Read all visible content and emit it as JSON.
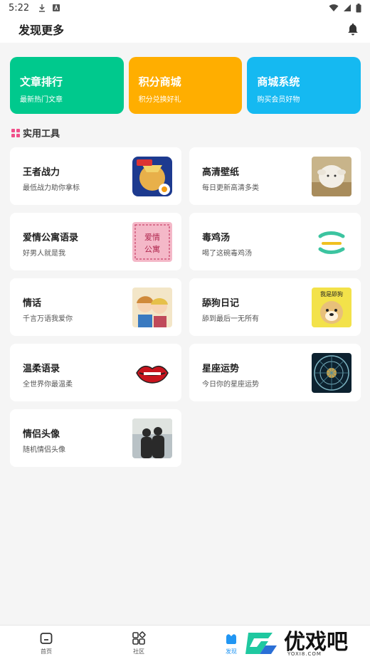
{
  "status_bar": {
    "time": "5:22"
  },
  "app_bar": {
    "title": "发现更多"
  },
  "features": [
    {
      "title": "文章排行",
      "subtitle": "最新热门文章",
      "color": "#00c98d"
    },
    {
      "title": "积分商城",
      "subtitle": "积分兑换好礼",
      "color": "#ffae00"
    },
    {
      "title": "商城系统",
      "subtitle": "购买会员好物",
      "color": "#15b9f1"
    }
  ],
  "section": {
    "title": "实用工具",
    "accent": "#f0508a"
  },
  "tools": [
    {
      "title": "王者战力",
      "subtitle": "最低战力助你拿标",
      "thumb": "game-hero-thumbnail"
    },
    {
      "title": "高清壁纸",
      "subtitle": "每日更新高清多类",
      "thumb": "plush-sheep-thumbnail"
    },
    {
      "title": "爱情公寓语录",
      "subtitle": "好男人就是我",
      "thumb": "love-apartment-thumbnail",
      "thumb_text": "爱情公寓"
    },
    {
      "title": "毒鸡汤",
      "subtitle": "喝了这碗毒鸡汤",
      "thumb": "chicken-soup-logo-thumbnail"
    },
    {
      "title": "情话",
      "subtitle": "千言万语我爱你",
      "thumb": "anime-couple-thumbnail"
    },
    {
      "title": "舔狗日记",
      "subtitle": "舔到最后一无所有",
      "thumb": "dog-meme-thumbnail",
      "thumb_text": "我是舔狗"
    },
    {
      "title": "温柔语录",
      "subtitle": "全世界你最温柔",
      "thumb": "red-lips-thumbnail"
    },
    {
      "title": "星座运势",
      "subtitle": "今日你的星座运势",
      "thumb": "zodiac-wheel-thumbnail"
    },
    {
      "title": "情侣头像",
      "subtitle": "随机情侣头像",
      "thumb": "couple-silhouette-thumbnail"
    }
  ],
  "bottom_nav": [
    {
      "label": "首页",
      "icon": "home-icon"
    },
    {
      "label": "社区",
      "icon": "grid-icon"
    },
    {
      "label": "发现",
      "icon": "discover-icon",
      "active": true
    }
  ],
  "watermark": {
    "text": "优戏吧",
    "sub": "YOXI8.COM"
  }
}
